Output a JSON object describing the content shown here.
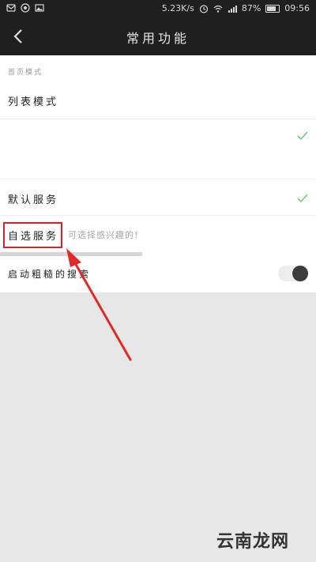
{
  "status_bar": {
    "net_speed": "5.23K/s",
    "battery_pct": "87%",
    "time": "09:56",
    "icons": [
      "message-icon",
      "alarm-icon",
      "wifi-icon",
      "signal-icon",
      "battery-icon"
    ]
  },
  "header": {
    "title": "常用功能"
  },
  "content": {
    "section_label": "首页模式",
    "list_mode_label": "列表模式",
    "default_service_label": "默认服务",
    "custom_service_label": "自选服务",
    "custom_service_hint": "可选择感兴趣的!",
    "toggle_row_label": "启动粗糙的搜索"
  },
  "watermark": "云南龙网",
  "colors": {
    "bar": "#1f1f1f",
    "check": "#6abf7b",
    "highlight": "#d8212b"
  }
}
